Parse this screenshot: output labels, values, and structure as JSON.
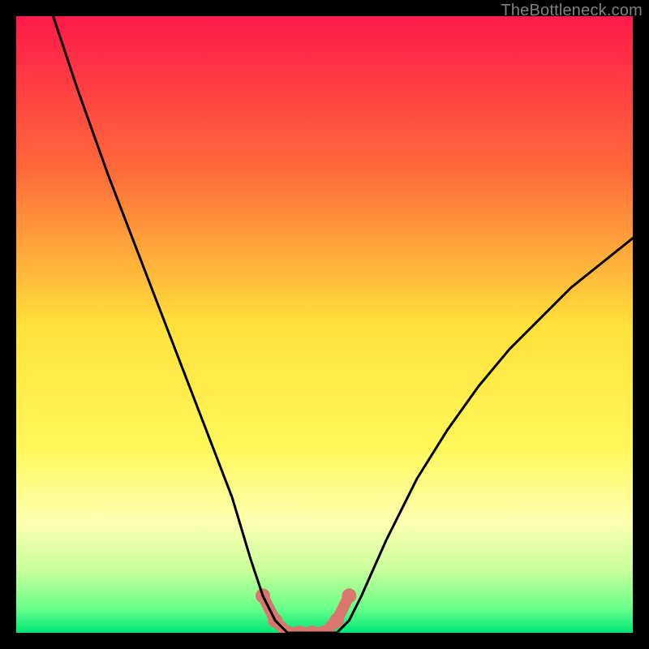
{
  "attribution": "TheBottleneck.com",
  "chart_data": {
    "type": "line",
    "title": "",
    "xlabel": "",
    "ylabel": "",
    "xlim": [
      0,
      100
    ],
    "ylim": [
      0,
      100
    ],
    "series": [
      {
        "name": "bottleneck-curve",
        "x": [
          6,
          10,
          15,
          20,
          25,
          30,
          35,
          38,
          40,
          42,
          44,
          46,
          48,
          50,
          52,
          54,
          56,
          60,
          65,
          70,
          75,
          80,
          85,
          90,
          95,
          100
        ],
        "y": [
          100,
          88,
          74,
          61,
          48,
          35,
          22,
          12,
          6,
          2,
          0,
          0,
          0,
          0,
          0,
          2,
          6,
          15,
          25,
          33,
          40,
          46,
          51,
          56,
          60,
          64
        ]
      }
    ],
    "markers": {
      "name": "optimal-range-markers",
      "points": [
        {
          "x": 40,
          "y": 6
        },
        {
          "x": 42,
          "y": 2
        },
        {
          "x": 44,
          "y": 0
        },
        {
          "x": 46,
          "y": 0
        },
        {
          "x": 48,
          "y": 0
        },
        {
          "x": 50,
          "y": 0
        },
        {
          "x": 52,
          "y": 2
        },
        {
          "x": 54,
          "y": 6
        }
      ]
    },
    "background": {
      "type": "vertical-gradient",
      "stops": [
        {
          "pos": 0.0,
          "color": "#ff1a4a"
        },
        {
          "pos": 0.25,
          "color": "#ff6a3a"
        },
        {
          "pos": 0.5,
          "color": "#ffe03a"
        },
        {
          "pos": 0.7,
          "color": "#fff85a"
        },
        {
          "pos": 0.82,
          "color": "#fdffb0"
        },
        {
          "pos": 0.9,
          "color": "#c8ff9a"
        },
        {
          "pos": 0.96,
          "color": "#6aff8a"
        },
        {
          "pos": 1.0,
          "color": "#00e676"
        }
      ]
    },
    "curve_color": "#000000",
    "marker_color": "#d9776e"
  }
}
